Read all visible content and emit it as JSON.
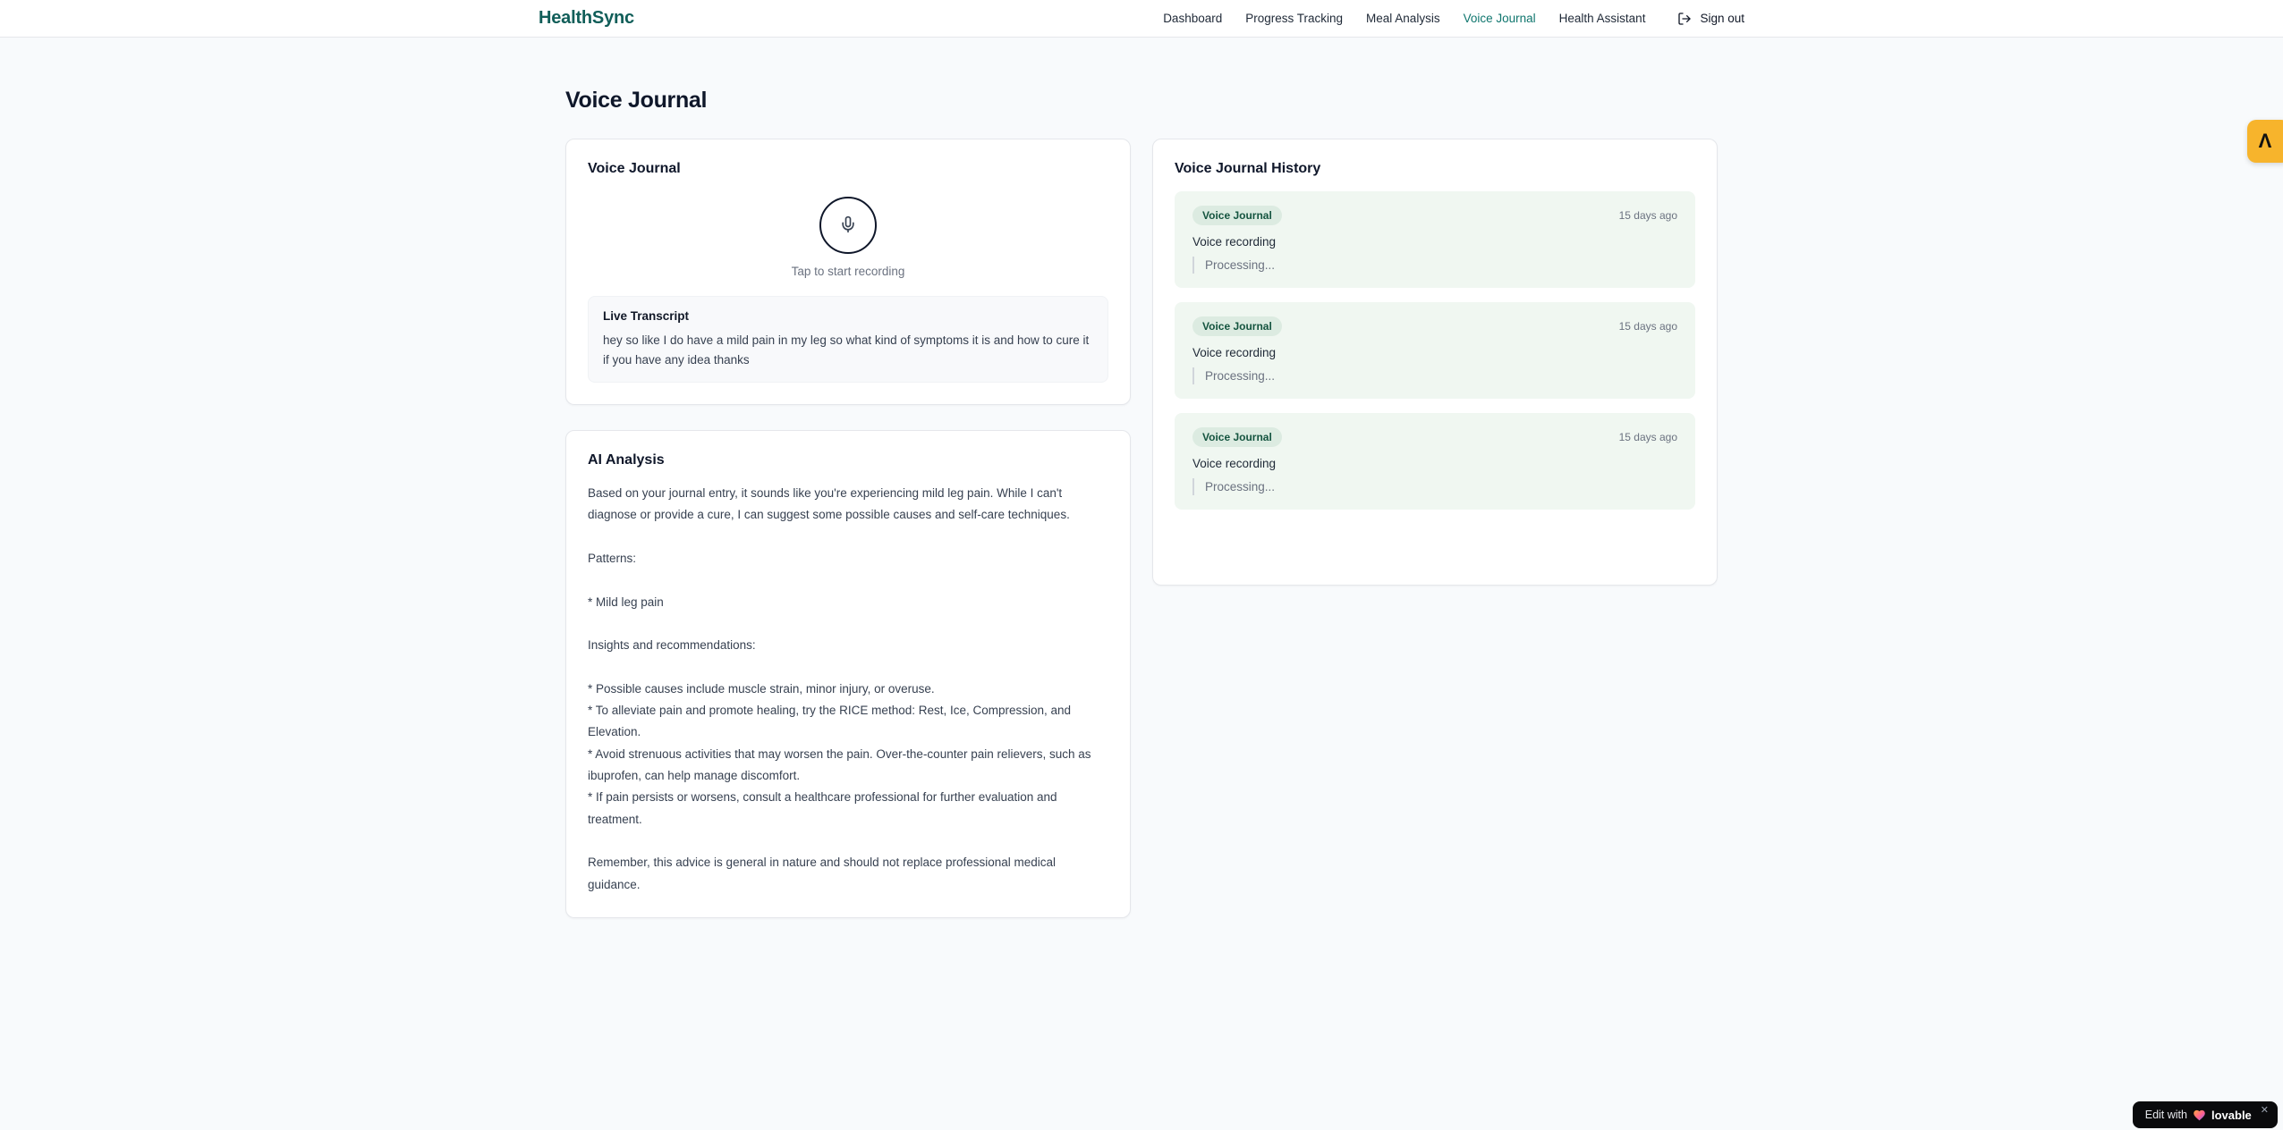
{
  "colors": {
    "brand_teal": "#115e59",
    "active_nav_teal": "#0f766e",
    "page_bg": "#f8fafc",
    "entry_bg": "#f0f7f1",
    "badge_bg": "#dcebe1",
    "badge_text": "#14543f",
    "side_widget_amber": "#f7b42c",
    "lovable_bg": "#0a0a0c"
  },
  "header": {
    "brand": "HealthSync",
    "nav": [
      {
        "label": "Dashboard"
      },
      {
        "label": "Progress Tracking"
      },
      {
        "label": "Meal Analysis"
      },
      {
        "label": "Voice Journal"
      },
      {
        "label": "Health Assistant"
      }
    ],
    "sign_out_label": "Sign out"
  },
  "page": {
    "title": "Voice Journal"
  },
  "recorder_card": {
    "title": "Voice Journal",
    "mic_icon": "microphone-icon",
    "tap_label": "Tap to start recording",
    "transcript": {
      "title": "Live Transcript",
      "text": "hey so like I do have a mild pain in my leg so what kind of symptoms it is and how to cure it if you have any idea thanks"
    }
  },
  "analysis_card": {
    "title": "AI Analysis",
    "body": "Based on your journal entry, it sounds like you're experiencing mild leg pain. While I can't diagnose or provide a cure, I can suggest some possible causes and self-care techniques.\n\nPatterns:\n\n* Mild leg pain\n\nInsights and recommendations:\n\n* Possible causes include muscle strain, minor injury, or overuse.\n* To alleviate pain and promote healing, try the RICE method: Rest, Ice, Compression, and Elevation.\n* Avoid strenuous activities that may worsen the pain. Over-the-counter pain relievers, such as ibuprofen, can help manage discomfort.\n* If pain persists or worsens, consult a healthcare professional for further evaluation and treatment.\n\nRemember, this advice is general in nature and should not replace professional medical guidance."
  },
  "history_card": {
    "title": "Voice Journal History",
    "entries": [
      {
        "badge": "Voice Journal",
        "time": "15 days ago",
        "summary": "Voice recording",
        "status": "Processing..."
      },
      {
        "badge": "Voice Journal",
        "time": "15 days ago",
        "summary": "Voice recording",
        "status": "Processing..."
      },
      {
        "badge": "Voice Journal",
        "time": "15 days ago",
        "summary": "Voice recording",
        "status": "Processing..."
      }
    ]
  },
  "overlays": {
    "side_widget": {
      "glyph": "Λ"
    },
    "lovable": {
      "prefix": "Edit with",
      "brand": "lovable",
      "close": "✕"
    }
  }
}
